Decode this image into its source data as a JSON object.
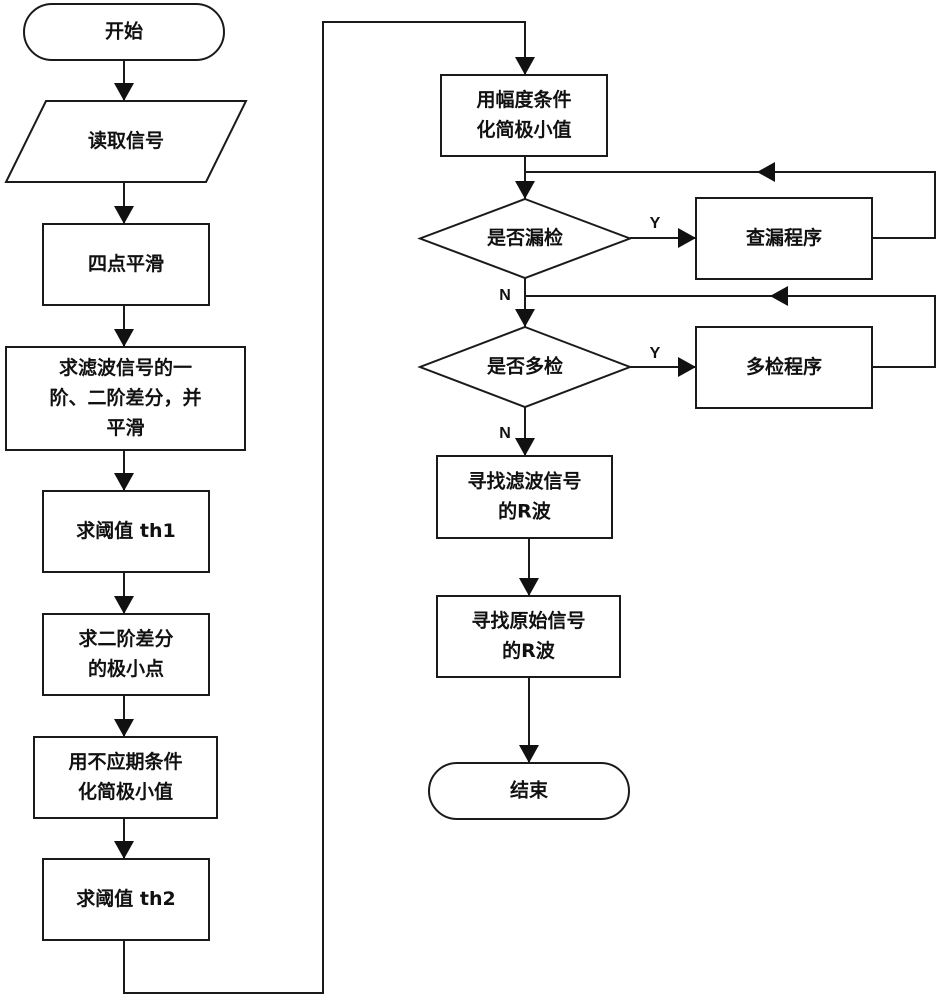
{
  "diagram": {
    "type": "flowchart",
    "nodes": [
      {
        "id": "start",
        "shape": "terminator",
        "lines": [
          "开始"
        ]
      },
      {
        "id": "read",
        "shape": "parallelogram",
        "lines": [
          "读取信号"
        ]
      },
      {
        "id": "smooth4",
        "shape": "process",
        "lines": [
          "四点平滑"
        ]
      },
      {
        "id": "diff",
        "shape": "process",
        "lines": [
          "求滤波信号的一",
          "阶、二阶差分，并",
          "平滑"
        ]
      },
      {
        "id": "th1",
        "shape": "process",
        "lines": [
          "求阈值 th1"
        ]
      },
      {
        "id": "minpts",
        "shape": "process",
        "lines": [
          "求二阶差分",
          "的极小点"
        ]
      },
      {
        "id": "refractory",
        "shape": "process",
        "lines": [
          "用不应期条件",
          "化简极小值"
        ]
      },
      {
        "id": "th2",
        "shape": "process",
        "lines": [
          "求阈值 th2"
        ]
      },
      {
        "id": "amplitude",
        "shape": "process",
        "lines": [
          "用幅度条件",
          "化简极小值"
        ]
      },
      {
        "id": "missed_q",
        "shape": "decision",
        "lines": [
          "是否漏检"
        ]
      },
      {
        "id": "missed_proc",
        "shape": "process",
        "lines": [
          "查漏程序"
        ]
      },
      {
        "id": "extra_q",
        "shape": "decision",
        "lines": [
          "是否多检"
        ]
      },
      {
        "id": "extra_proc",
        "shape": "process",
        "lines": [
          "多检程序"
        ]
      },
      {
        "id": "r_filtered",
        "shape": "process",
        "lines": [
          "寻找滤波信号",
          "的R波"
        ]
      },
      {
        "id": "r_original",
        "shape": "process",
        "lines": [
          "寻找原始信号",
          "的R波"
        ]
      },
      {
        "id": "end",
        "shape": "terminator",
        "lines": [
          "结束"
        ]
      }
    ],
    "edges": [
      {
        "from": "start",
        "to": "read",
        "label": ""
      },
      {
        "from": "read",
        "to": "smooth4",
        "label": ""
      },
      {
        "from": "smooth4",
        "to": "diff",
        "label": ""
      },
      {
        "from": "diff",
        "to": "th1",
        "label": ""
      },
      {
        "from": "th1",
        "to": "minpts",
        "label": ""
      },
      {
        "from": "minpts",
        "to": "refractory",
        "label": ""
      },
      {
        "from": "refractory",
        "to": "th2",
        "label": ""
      },
      {
        "from": "th2",
        "to": "amplitude",
        "label": ""
      },
      {
        "from": "amplitude",
        "to": "missed_q",
        "label": ""
      },
      {
        "from": "missed_q",
        "to": "missed_proc",
        "label": "Y"
      },
      {
        "from": "missed_proc",
        "to": "missed_q",
        "label": ""
      },
      {
        "from": "missed_q",
        "to": "extra_q",
        "label": "N"
      },
      {
        "from": "extra_q",
        "to": "extra_proc",
        "label": "Y"
      },
      {
        "from": "extra_proc",
        "to": "extra_q",
        "label": ""
      },
      {
        "from": "extra_q",
        "to": "r_filtered",
        "label": "N"
      },
      {
        "from": "r_filtered",
        "to": "r_original",
        "label": ""
      },
      {
        "from": "r_original",
        "to": "end",
        "label": ""
      }
    ]
  }
}
